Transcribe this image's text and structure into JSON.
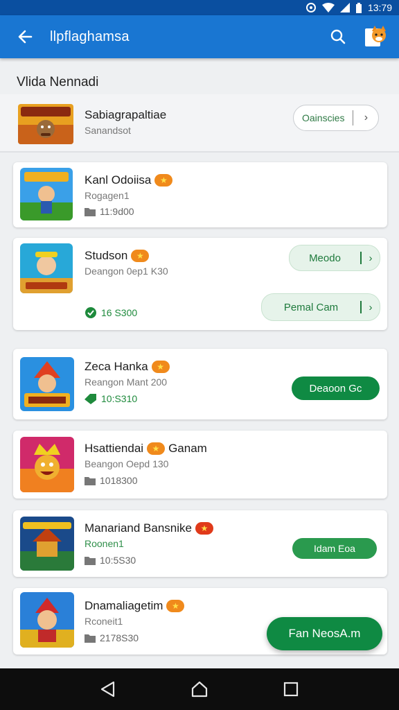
{
  "status": {
    "time": "13:79"
  },
  "app_bar": {
    "title": "llpflaghamsa",
    "back_icon": "arrow-left-icon",
    "search_icon": "search-icon",
    "profile_icon": "fox-avatar-icon"
  },
  "section": {
    "title": "Vlida Nennadi"
  },
  "featured": {
    "name": "Sabiagrapaltiae",
    "subtitle": "Sanandsot",
    "button_label": "Oainscies",
    "chevron": "›"
  },
  "games": [
    {
      "name": "Kanl Odoiisa",
      "subtitle": "Rogagen1",
      "meta": "11:9d00",
      "meta_icon": "folder-icon"
    },
    {
      "name": "Studson",
      "subtitle": "Deangon 0ep1 K30",
      "meta": "16 S300",
      "meta_icon": "check-circle-icon",
      "buttons": [
        {
          "label": "Meodo",
          "chevron": "›"
        },
        {
          "label": "Pemal Cam",
          "chevron": "›"
        }
      ]
    },
    {
      "name": "Zeca Hanka",
      "subtitle": "Reangon Mant 200",
      "meta": "10:S310",
      "meta_icon": "tag-icon",
      "button_label": "Deaoon Gc"
    },
    {
      "name": "Hsattiendai",
      "name_suffix": "Ganam",
      "subtitle": "Beangon Oepd 130",
      "meta": "1018300",
      "meta_icon": "folder-icon"
    },
    {
      "name": "Manariand Bansnike",
      "subtitle": "Roonen1",
      "meta": "10:5S30",
      "meta_icon": "folder-icon",
      "button_label": "Idam Eoa"
    },
    {
      "name": "Dnamaliagetim",
      "subtitle": "Rconeit1",
      "meta": "2178S30",
      "meta_icon": "folder-icon"
    }
  ],
  "fab": {
    "label": "Fan NeosA.m"
  },
  "nav": {
    "back_icon": "nav-back-icon",
    "home_icon": "nav-home-icon",
    "recents_icon": "nav-recents-icon"
  }
}
